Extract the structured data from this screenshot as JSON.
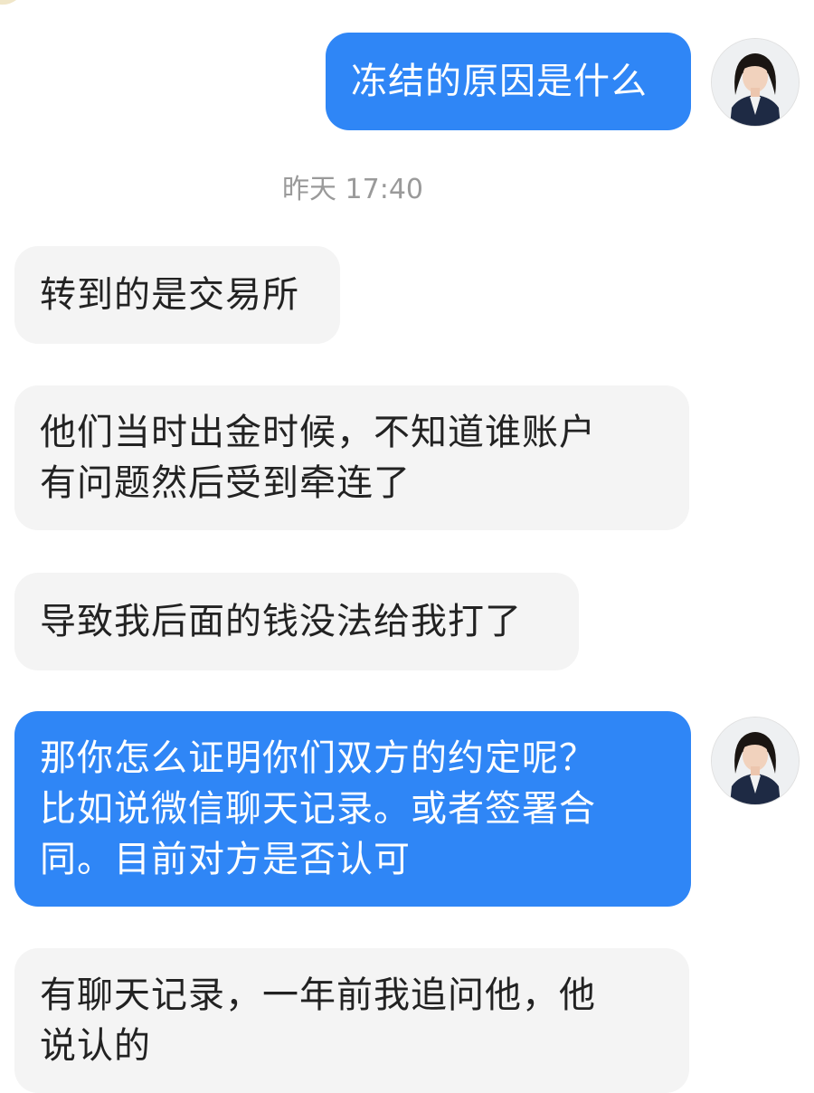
{
  "colors": {
    "outgoing_bubble": "#2f86f6",
    "incoming_bubble": "#f4f4f4",
    "incoming_text": "#222222",
    "timestamp_text": "#9a9a9a"
  },
  "messages": {
    "m1": {
      "direction": "outgoing",
      "text": "冻结的原因是什么"
    },
    "timestamp": "昨天 17:40",
    "m2": {
      "direction": "incoming",
      "text": "转到的是交易所"
    },
    "m3": {
      "direction": "incoming",
      "text": "他们当时出金时候，不知道谁账户\n有问题然后受到牵连了"
    },
    "m4": {
      "direction": "incoming",
      "text": "导致我后面的钱没法给我打了"
    },
    "m5": {
      "direction": "outgoing",
      "text": "那你怎么证明你们双方的约定呢？\n比如说微信聊天记录。或者签署合\n同。目前对方是否认可"
    },
    "m6": {
      "direction": "incoming",
      "text": "有聊天记录，一年前我追问他，他\n说认的"
    }
  },
  "icons": {
    "avatar": "user-avatar-icon"
  }
}
